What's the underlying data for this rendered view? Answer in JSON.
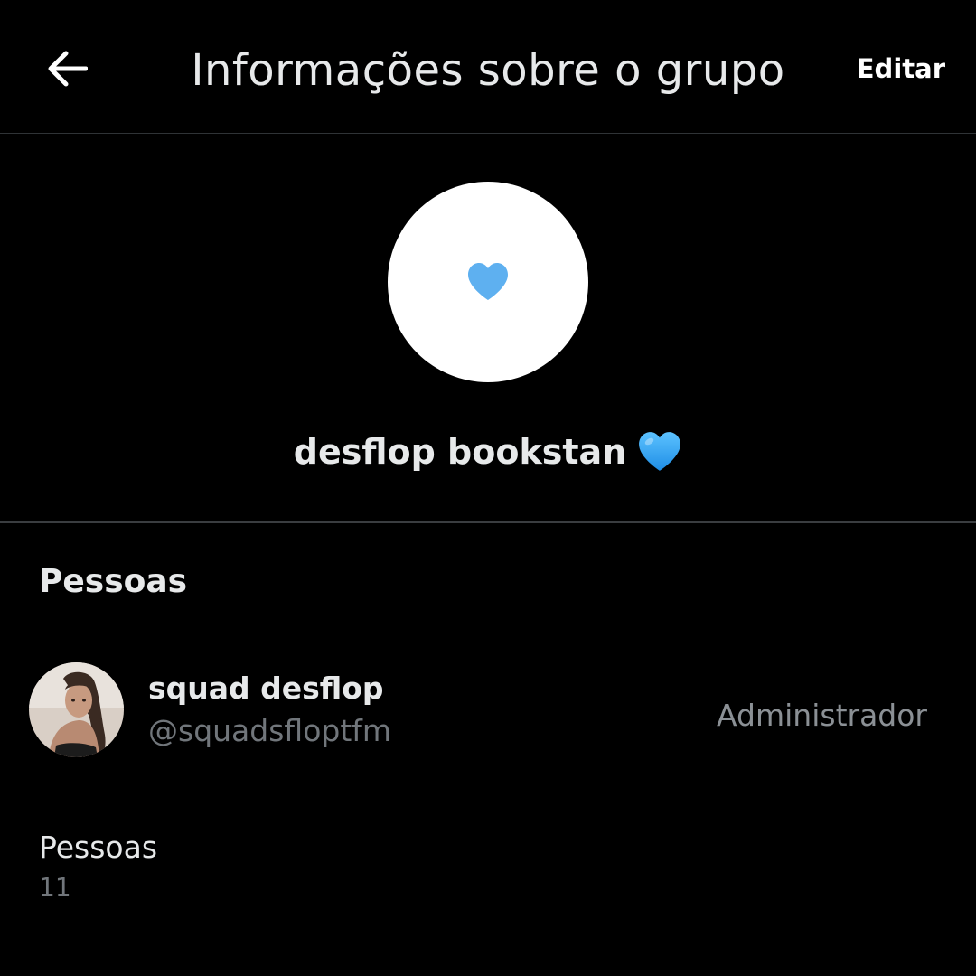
{
  "header": {
    "title": "Informações sobre o grupo",
    "edit_label": "Editar",
    "back_icon": "arrow-left-icon"
  },
  "group": {
    "name": "desflop bookstan",
    "avatar_emoji": "blue-heart",
    "avatar_background": "#ffffff",
    "heart_color": "#5eb0f0"
  },
  "people_section": {
    "title": "Pessoas",
    "members": [
      {
        "display_name": "squad desflop",
        "handle": "@squadsfloptfm",
        "role": "Administrador"
      }
    ],
    "count_label": "Pessoas",
    "count_value": "11"
  },
  "colors": {
    "background": "#000000",
    "primary_text": "#e7e9ea",
    "secondary_text": "#71767b",
    "divider": "#2f3336"
  }
}
